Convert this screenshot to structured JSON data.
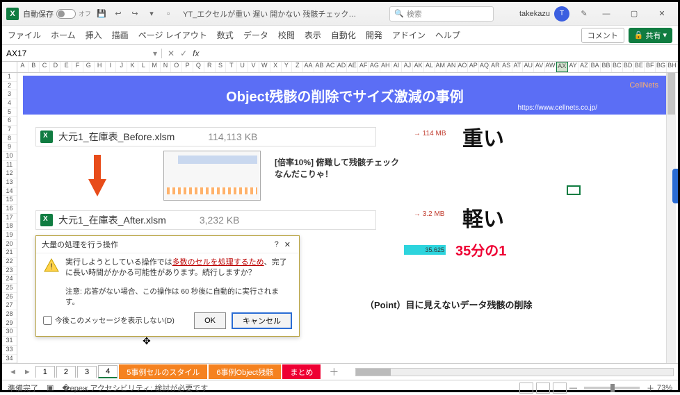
{
  "titlebar": {
    "autosave_label": "自動保存",
    "autosave_state": "オフ",
    "filename": "YT_エクセルが重い 遅い 開かない 残骸チェックで原因究明…",
    "search_placeholder": "検索",
    "username": "takekazu",
    "avatar_initial": "T"
  },
  "ribbon": {
    "tabs": [
      "ファイル",
      "ホーム",
      "挿入",
      "描画",
      "ページ レイアウト",
      "数式",
      "データ",
      "校閲",
      "表示",
      "自動化",
      "開発",
      "アドイン",
      "ヘルプ"
    ],
    "comment": "コメント",
    "share": "共有"
  },
  "formulabar": {
    "namebox": "AX17"
  },
  "columns": [
    "A",
    "B",
    "C",
    "D",
    "E",
    "F",
    "G",
    "H",
    "I",
    "J",
    "K",
    "L",
    "M",
    "N",
    "O",
    "P",
    "Q",
    "R",
    "S",
    "T",
    "U",
    "V",
    "W",
    "X",
    "Y",
    "Z",
    "AA",
    "AB",
    "AC",
    "AD",
    "AE",
    "AF",
    "AG",
    "AH",
    "AI",
    "AJ",
    "AK",
    "AL",
    "AM",
    "AN",
    "AO",
    "AP",
    "AQ",
    "AR",
    "AS",
    "AT",
    "AU",
    "AV",
    "AW",
    "AX",
    "AY",
    "AZ",
    "BA",
    "BB",
    "BC",
    "BD",
    "BE",
    "BF",
    "BG",
    "BH"
  ],
  "selected_col": "AX",
  "rows": [
    "1",
    "2",
    "3",
    "4",
    "5",
    "6",
    "7",
    "8",
    "9",
    "10",
    "11",
    "12",
    "13",
    "14",
    "15",
    "16",
    "17",
    "18",
    "19",
    "20",
    "21",
    "22",
    "23",
    "24",
    "25",
    "26",
    "27",
    "28",
    "29",
    "30",
    "31",
    "33",
    "34"
  ],
  "banner": {
    "title": "Object残骸の削除でサイズ激減の事例",
    "brand": "CellNets",
    "url": "https://www.cellnets.co.jp/"
  },
  "file_before": {
    "name": "大元1_在庫表_Before.xlsm",
    "size": "114,113 KB"
  },
  "file_after": {
    "name": "大元1_在庫表_After.xlsm",
    "size": "3,232 KB"
  },
  "msg_check": "[倍率10%] 俯瞰して残骸チェック\nなんだこりゃ！",
  "mb_before": "→ 114 MB",
  "mb_after": "→ 3.2 MB",
  "label_heavy": "重い",
  "label_light": "軽い",
  "ratio_value": "35.625",
  "ratio_text": "35分の1",
  "point_text": "（Point）目に見えないデータ残骸の削除",
  "dialog": {
    "title": "大量の処理を行う操作",
    "warn_pre": "実行しようとしている操作では",
    "warn_hl": "多数のセルを処理するため",
    "warn_post": "、完了に長い時間がかかる可能性があります。続行しますか？",
    "note": "注意: 応答がない場合、この操作は 60 秒後に自動的に実行されます。",
    "checkbox": "今後このメッセージを表示しない(D)",
    "ok": "OK",
    "cancel": "キャンセル"
  },
  "sheettabs": {
    "numeric": [
      "1",
      "2",
      "3",
      "4"
    ],
    "s5": "5事例セルのスタイル",
    "s6": "6事例Object残骸",
    "s7": "まとめ"
  },
  "statusbar": {
    "ready": "準備完了",
    "acc": "アクセシビリティ: 検討が必要です",
    "zoom": "73%"
  }
}
